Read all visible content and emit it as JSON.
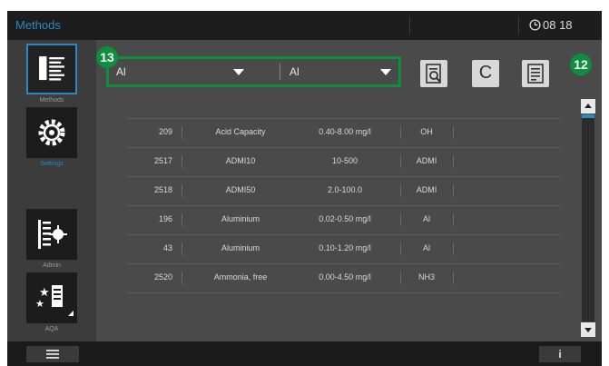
{
  "header": {
    "title": "Methods",
    "time": "08 18"
  },
  "sidebar": {
    "items": [
      {
        "label": "Methods",
        "icon": "list-icon",
        "active": true
      },
      {
        "label": "Settings",
        "icon": "gear-icon",
        "active": false
      },
      {
        "label": "Admin",
        "icon": "admin-icon",
        "active": false
      },
      {
        "label": "AQA",
        "icon": "aqa-icon",
        "active": false
      }
    ]
  },
  "filters": {
    "left_value": "Al",
    "right_value": "Al"
  },
  "toolbar": {
    "buttons": [
      "search-doc-icon",
      "c-icon",
      "info-doc-icon"
    ],
    "c_label": "C"
  },
  "callouts": {
    "left": "13",
    "right": "12"
  },
  "table": {
    "rows": [
      {
        "number": "209",
        "name": "Acid Capacity",
        "range": "0.40-8.00 mg/l",
        "unit": "OH"
      },
      {
        "number": "2517",
        "name": "ADMI10",
        "range": "10-500",
        "unit": "ADMI"
      },
      {
        "number": "2518",
        "name": "ADMI50",
        "range": "2.0-100.0",
        "unit": "ADMI"
      },
      {
        "number": "196",
        "name": "Aluminium",
        "range": "0.02-0.50 mg/l",
        "unit": "Al"
      },
      {
        "number": "43",
        "name": "Aluminium",
        "range": "0.10-1.20 mg/l",
        "unit": "Al"
      },
      {
        "number": "2520",
        "name": "Ammonia, free",
        "range": "0.00-4.50 mg/l",
        "unit": "NH3"
      }
    ]
  },
  "footer": {
    "info_label": "i"
  },
  "colors": {
    "accent": "#2f86c4",
    "callout_green": "#0e8f3f"
  }
}
